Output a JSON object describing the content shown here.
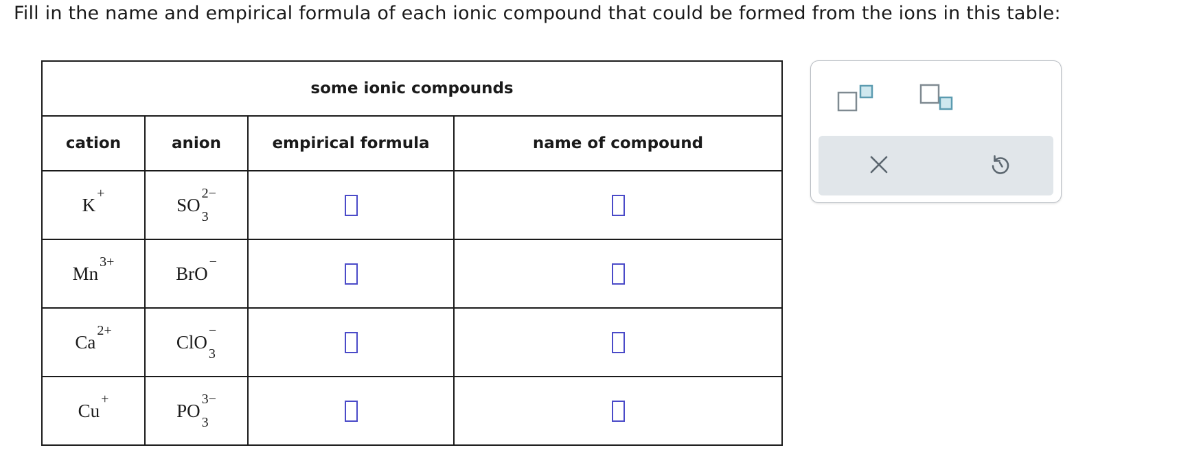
{
  "prompt": "Fill in the name and empirical formula of each ionic compound that could be formed from the ions in this table:",
  "table": {
    "title": "some ionic compounds",
    "headers": {
      "cation": "cation",
      "anion": "anion",
      "formula": "empirical formula",
      "name": "name of compound"
    },
    "rows": [
      {
        "cation": {
          "base": "K",
          "charge": "+",
          "sub": ""
        },
        "anion": {
          "base": "SO",
          "charge": "2−",
          "sub": "3"
        },
        "formula": "",
        "name": ""
      },
      {
        "cation": {
          "base": "Mn",
          "charge": "3+",
          "sub": ""
        },
        "anion": {
          "base": "BrO",
          "charge": "−",
          "sub": ""
        },
        "formula": "",
        "name": ""
      },
      {
        "cation": {
          "base": "Ca",
          "charge": "2+",
          "sub": ""
        },
        "anion": {
          "base": "ClO",
          "charge": "−",
          "sub": "3"
        },
        "formula": "",
        "name": ""
      },
      {
        "cation": {
          "base": "Cu",
          "charge": "+",
          "sub": ""
        },
        "anion": {
          "base": "PO",
          "charge": "3−",
          "sub": "3"
        },
        "formula": "",
        "name": ""
      }
    ]
  },
  "tools": {
    "superscript_icon": "superscript-box-icon",
    "subscript_icon": "subscript-box-icon",
    "clear_icon": "x-icon",
    "undo_icon": "undo-icon"
  },
  "colors": {
    "input_border": "#4a4ac8",
    "tool_teal": "#5b9bb0",
    "tool_fill": "#cfe8ef",
    "tool_gray": "#7f8a91",
    "action_bar": "#e1e6ea"
  }
}
